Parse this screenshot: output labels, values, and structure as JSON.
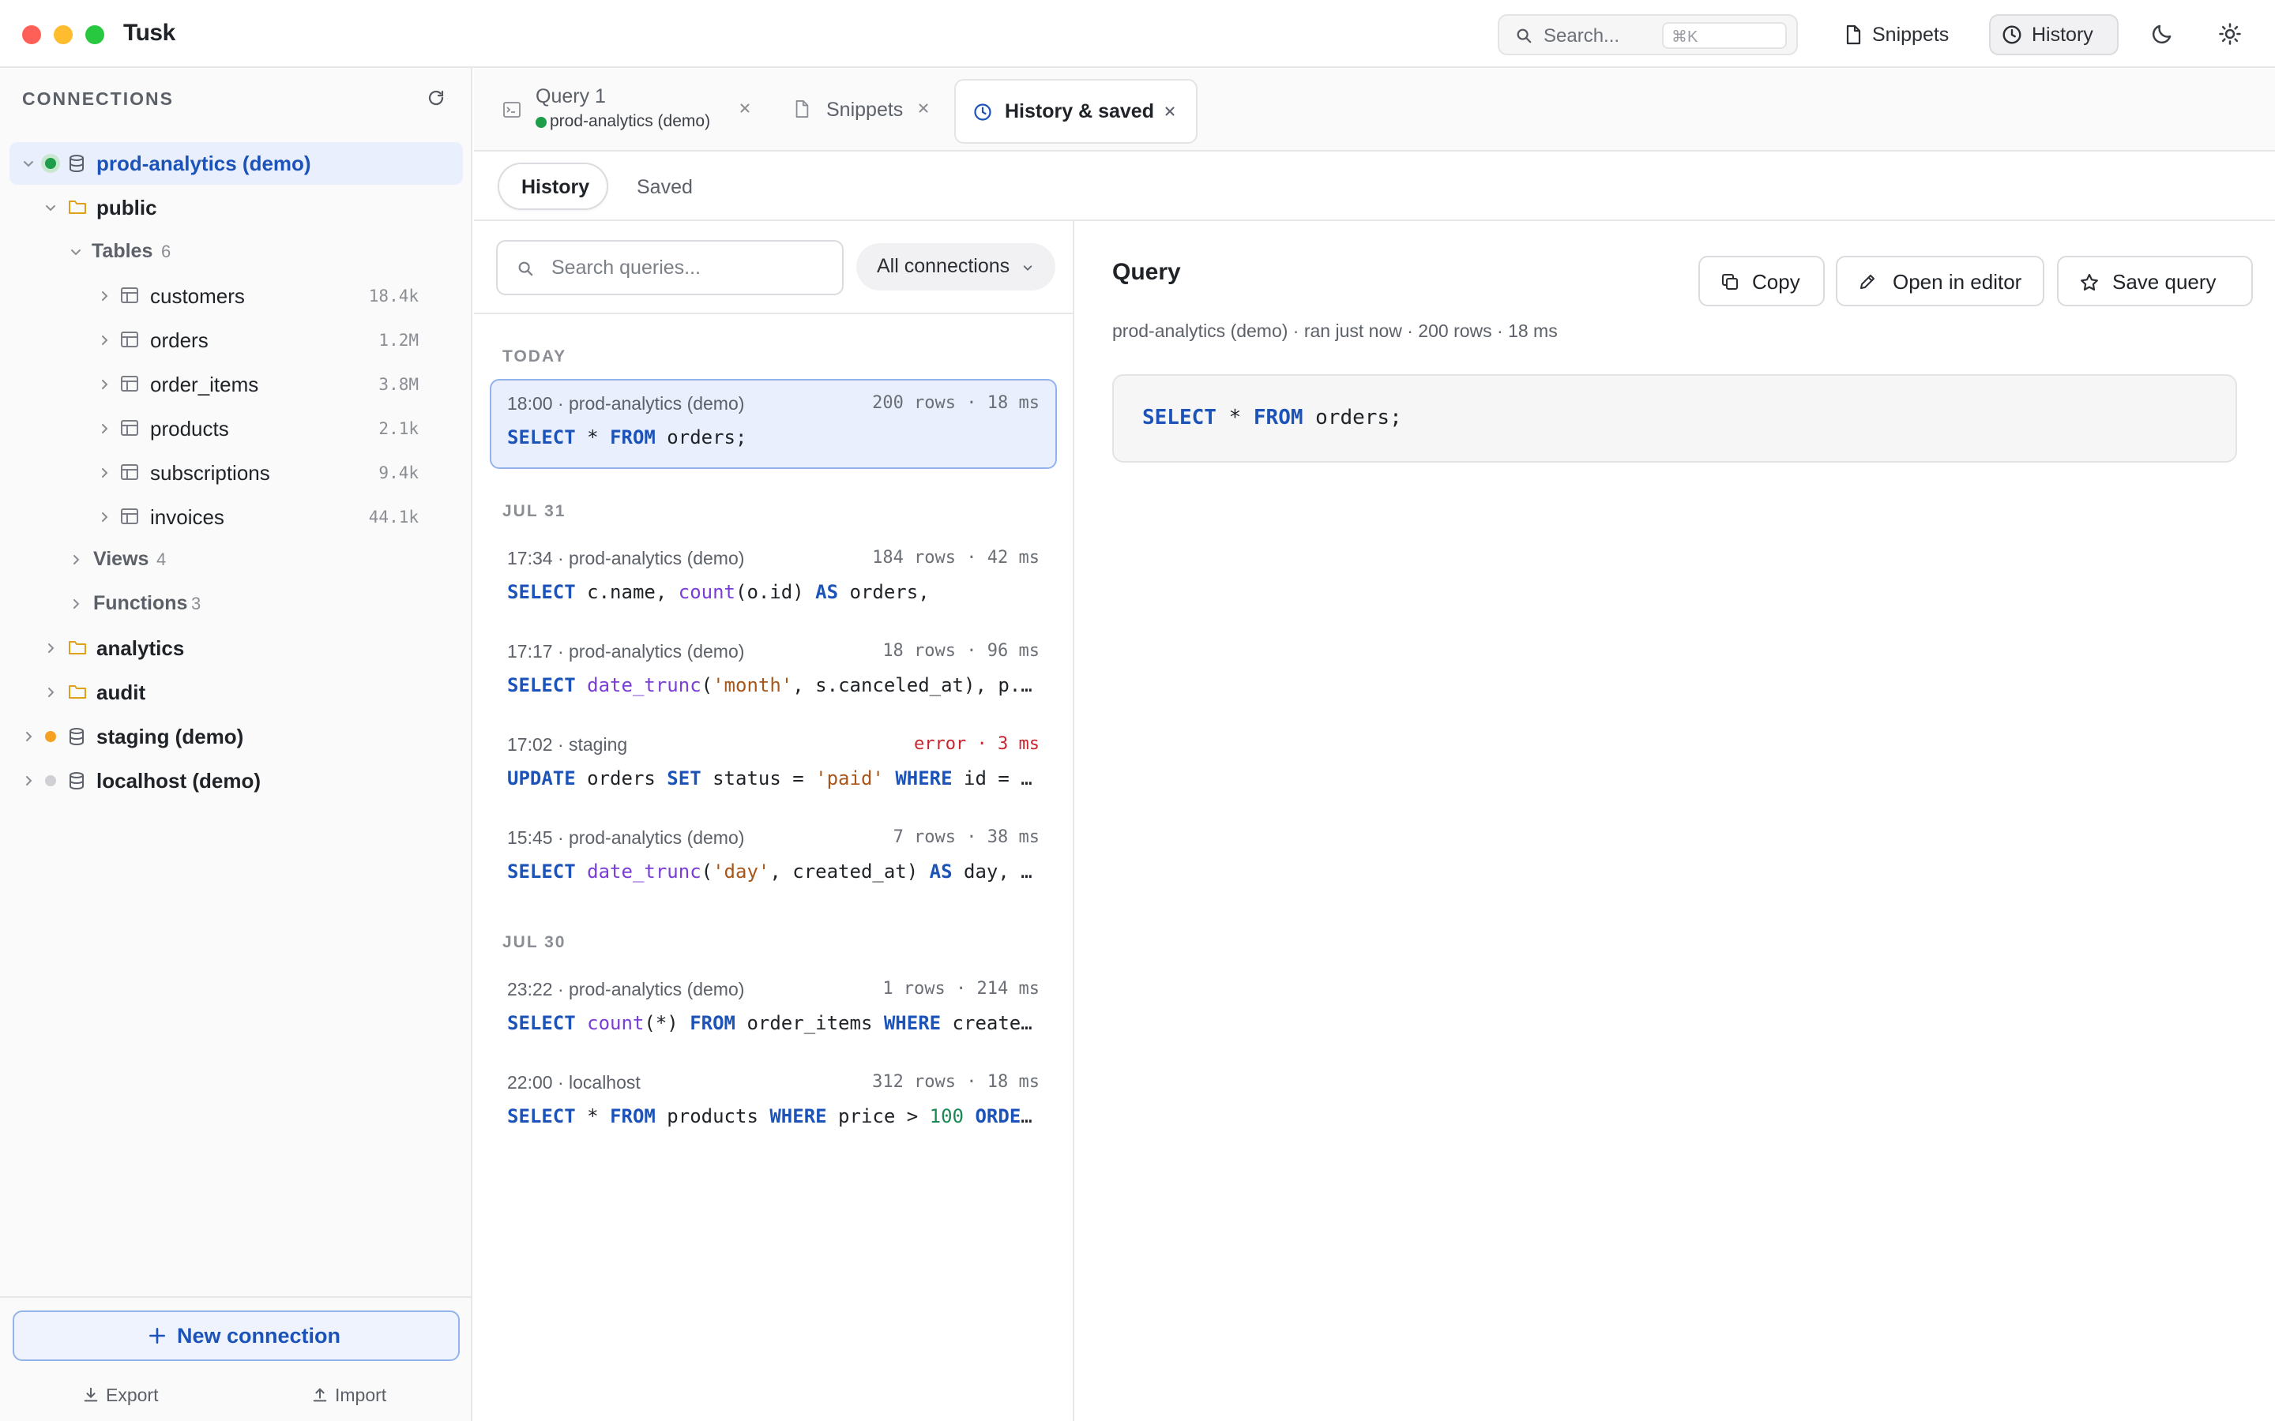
{
  "window": {
    "title": "Tusk",
    "search_placeholder": "Search...",
    "search_shortcut": "⌘K",
    "snippets_label": "Snippets",
    "history_label": "History",
    "icons": [
      "search-icon",
      "document-icon",
      "clock-icon",
      "moon-icon",
      "sun-icon"
    ]
  },
  "sidebar": {
    "header": "CONNECTIONS",
    "connections": [
      {
        "name": "prod-analytics (demo)",
        "status_color": "#1e9e4a",
        "expanded": true
      },
      {
        "name": "staging (demo)",
        "status_color": "#f5a020",
        "expanded": false
      },
      {
        "name": "localhost (demo)",
        "status_color": "#cfd0d4",
        "expanded": false
      }
    ],
    "schemas": [
      "public",
      "analytics",
      "audit"
    ],
    "tables_label": "Tables",
    "tables_count": "6",
    "tables": [
      {
        "name": "customers",
        "size": "18.4k"
      },
      {
        "name": "orders",
        "size": "1.2M"
      },
      {
        "name": "order_items",
        "size": "3.8M"
      },
      {
        "name": "products",
        "size": "2.1k"
      },
      {
        "name": "subscriptions",
        "size": "9.4k"
      },
      {
        "name": "invoices",
        "size": "44.1k"
      }
    ],
    "views_label": "Views",
    "views_count": "4",
    "functions_label": "Functions",
    "functions_count": "3",
    "new_connection": "New connection",
    "export": "Export",
    "import": "Import"
  },
  "tabs": {
    "query1": {
      "title": "Query 1",
      "connection": "prod-analytics (demo)"
    },
    "snippets": {
      "title": "Snippets"
    },
    "history": {
      "title": "History & saved",
      "active": true
    }
  },
  "subtabs": {
    "history": "History",
    "saved": "Saved",
    "active": "History"
  },
  "history_list": {
    "search_placeholder": "Search queries...",
    "connection_filter": "All connections",
    "groups": [
      {
        "label": "TODAY",
        "items": [
          {
            "meta": "18:00 · prod-analytics (demo)",
            "stats": "200 rows · 18 ms",
            "error": false,
            "selected": true,
            "sql": "SELECT * FROM orders;"
          }
        ]
      },
      {
        "label": "JUL 31",
        "items": [
          {
            "meta": "17:34 · prod-analytics (demo)",
            "stats": "184 rows · 42 ms",
            "error": false,
            "sql": "SELECT c.name, count(o.id) AS orders,"
          },
          {
            "meta": "17:17 · prod-analytics (demo)",
            "stats": "18 rows · 96 ms",
            "error": false,
            "sql": "SELECT date_trunc('month', s.canceled_at), p...."
          },
          {
            "meta": "17:02 · staging",
            "stats": "error · 3 ms",
            "error": true,
            "sql": "UPDATE orders SET status = 'paid' WHERE id = ..."
          },
          {
            "meta": "15:45 · prod-analytics (demo)",
            "stats": "7 rows · 38 ms",
            "error": false,
            "sql": "SELECT date_trunc('day', created_at) AS day, ..."
          }
        ]
      },
      {
        "label": "JUL 30",
        "items": [
          {
            "meta": "23:22 · prod-analytics (demo)",
            "stats": "1 rows · 214 ms",
            "error": false,
            "sql": "SELECT count(*) FROM order_items WHERE create..."
          },
          {
            "meta": "22:00 · localhost",
            "stats": "312 rows · 18 ms",
            "error": false,
            "sql": "SELECT * FROM products WHERE price > 100 ORDE..."
          }
        ]
      }
    ]
  },
  "detail": {
    "title": "Query",
    "copy": "Copy",
    "open_in_editor": "Open in editor",
    "save_query": "Save query",
    "meta": "prod-analytics (demo) · ran just now · 200 rows · 18 ms",
    "sql": "SELECT * FROM orders;"
  },
  "colors": {
    "accent": "#1c53b8",
    "selected_bg": "#e9effc",
    "keyword": "#1c53b8",
    "function": "#7a3ed6",
    "string": "#a8561a",
    "number": "#1a8a55",
    "error": "#c9252d"
  }
}
